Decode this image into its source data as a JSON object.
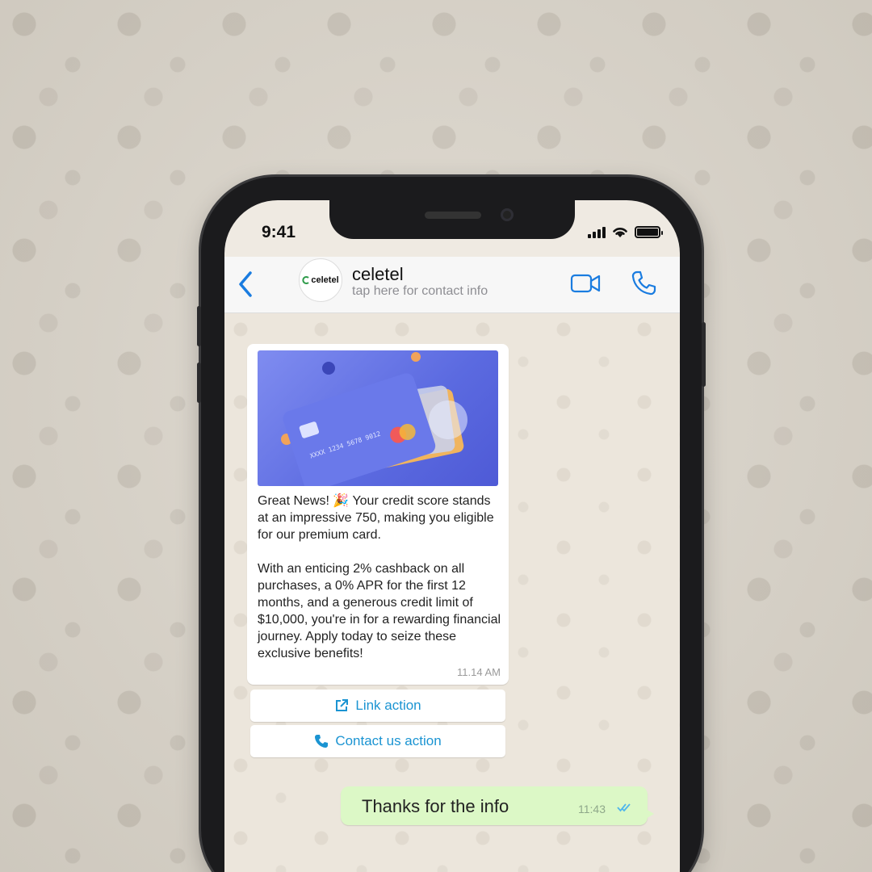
{
  "status_bar": {
    "time": "9:41"
  },
  "header": {
    "avatar_text": "celetel",
    "contact_name": "celetel",
    "contact_subtitle": "tap here for contact info",
    "back_icon": "chevron-left-icon",
    "video_icon": "video-camera-icon",
    "call_icon": "phone-icon"
  },
  "incoming_message": {
    "paragraph_1": "Great News! 🎉 Your credit score stands at an impressive 750, making you eligible for our premium card.",
    "paragraph_2": "With an enticing 2% cashback on all purchases, a 0% APR for the first 12 months, and a generous credit limit of $10,000, you're in for a rewarding financial journey. Apply today to seize these exclusive benefits!",
    "time": "11.14 AM",
    "card_number": "XXXX 1234 5678 9012"
  },
  "actions": {
    "link_label": "Link action",
    "contact_label": "Contact us action"
  },
  "outgoing_message": {
    "text": "Thanks for the info",
    "time": "11:43"
  },
  "colors": {
    "accent_blue": "#1b94d2",
    "ios_blue": "#1a7ce0",
    "outgoing_bubble": "#dcf8c6",
    "card_purple": "#5b6ae0"
  }
}
